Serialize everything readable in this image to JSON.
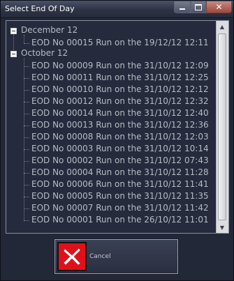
{
  "window": {
    "title": "Select End Of Day"
  },
  "tree": {
    "groups": [
      {
        "label": "December 12",
        "items": [
          "EOD No 00015 Run on the 19/12/12 12:11"
        ]
      },
      {
        "label": "October 12",
        "items": [
          "EOD No 00009 Run on the 31/10/12 12:09",
          "EOD No 00011 Run on the 31/10/12 12:25",
          "EOD No 00010 Run on the 31/10/12 12:12",
          "EOD No 00012 Run on the 31/10/12 12:32",
          "EOD No 00014 Run on the 31/10/12 12:40",
          "EOD No 00013 Run on the 31/10/12 12:36",
          "EOD No 00008 Run on the 31/10/12 12:03",
          "EOD No 00003 Run on the 31/10/12 10:14",
          "EOD No 00002 Run on the 31/10/12 07:43",
          "EOD No 00004 Run on the 31/10/12 11:28",
          "EOD No 00006 Run on the 31/10/12 11:41",
          "EOD No 00005 Run on the 31/10/12 11:35",
          "EOD No 00007 Run on the 31/10/12 11:42",
          "EOD No 00001 Run on the 26/10/12 11:01"
        ]
      }
    ]
  },
  "buttons": {
    "cancel_label": "Cancel"
  },
  "icons": {
    "expand": "minus-box-icon",
    "cancel": "red-x-icon",
    "minimize": "minimize-icon",
    "maximize": "maximize-icon",
    "close": "close-icon"
  },
  "colors": {
    "cancel_icon": "#e0101a",
    "background": "#232839",
    "text": "#b8bcc6"
  }
}
